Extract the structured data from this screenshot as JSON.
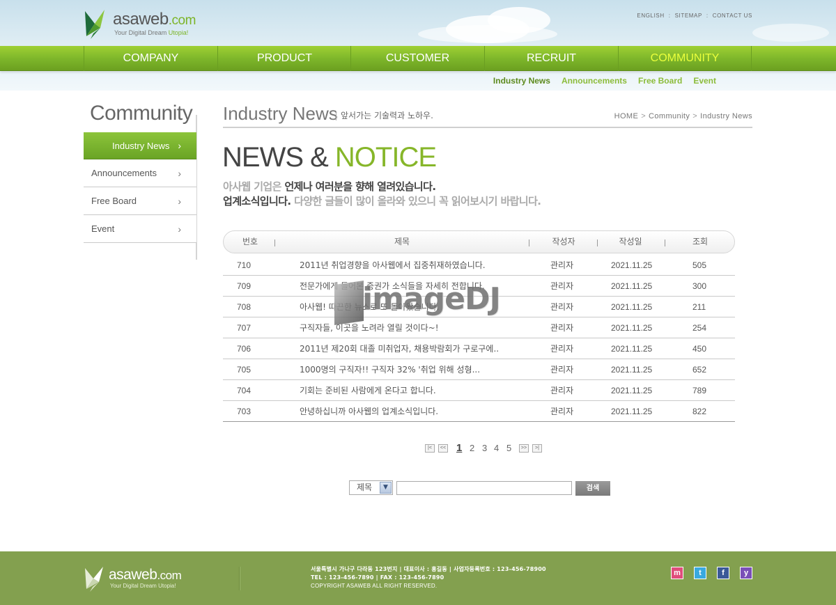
{
  "header": {
    "logo": {
      "brand": "asaweb",
      "domain": ".com",
      "tagline_prefix": "Your Digital Dream ",
      "tagline_accent": "Utopia!"
    },
    "util_nav": [
      "ENGLISH",
      "SITEMAP",
      "CONTACT US"
    ],
    "gnb": [
      "COMPANY",
      "PRODUCT",
      "CUSTOMER",
      "RECRUIT",
      "COMMUNITY"
    ],
    "gnb_active": "COMMUNITY",
    "subnav": [
      "Industry News",
      "Announcements",
      "Free Board",
      "Event"
    ],
    "subnav_active": "Industry News"
  },
  "sidebar": {
    "title": "Community",
    "items": [
      {
        "label": "Industry News",
        "active": true
      },
      {
        "label": "Announcements",
        "active": false
      },
      {
        "label": "Free Board",
        "active": false
      },
      {
        "label": "Event",
        "active": false
      }
    ],
    "arrow_glyph": "›"
  },
  "content": {
    "title": "Industry News",
    "subtitle": "앞서가는 기술력과 노하우.",
    "breadcrumb": [
      "HOME",
      "Community",
      "Industry News"
    ],
    "breadcrumb_sep": ">",
    "hero_dark": "NEWS & ",
    "hero_green": "NOTICE",
    "intro_line1_light": "아사웹 기업은 ",
    "intro_line1_dark": "언제나 여러분을 향해 열려있습니다.",
    "intro_line2_dark": "업계소식입니다. ",
    "intro_line2_light": "다양한 글들이 많이 올라와 있으니 꼭 읽어보시기 바랍니다."
  },
  "board": {
    "columns": [
      "번호",
      "제목",
      "작성자",
      "작성일",
      "조회"
    ],
    "rows": [
      {
        "no": "710",
        "title": "2011년 취업경향을 아사웹에서 집중취재하였습니다.",
        "writer": "관리자",
        "date": "2021.11.25",
        "views": "505"
      },
      {
        "no": "709",
        "title": "전문가에게 들어본 증권가 소식들을 자세히 전합니다.",
        "writer": "관리자",
        "date": "2021.11.25",
        "views": "300"
      },
      {
        "no": "708",
        "title": "아사웹! 따끈한 뉴스로 또 돌아왔습니다.",
        "writer": "관리자",
        "date": "2021.11.25",
        "views": "211"
      },
      {
        "no": "707",
        "title": "구직자들, 이곳을 노려라 열릴 것이다~!",
        "writer": "관리자",
        "date": "2021.11.25",
        "views": "254"
      },
      {
        "no": "706",
        "title": "2011년 제20회 대졸 미취업자, 채용박람회가 구로구에..",
        "writer": "관리자",
        "date": "2021.11.25",
        "views": "450"
      },
      {
        "no": "705",
        "title": "1000명의 구직자!! 구직자 32% '취업 위해 성형...",
        "writer": "관리자",
        "date": "2021.11.25",
        "views": "652"
      },
      {
        "no": "704",
        "title": "기회는 준비된 사람에게 온다고 합니다.",
        "writer": "관리자",
        "date": "2021.11.25",
        "views": "789"
      },
      {
        "no": "703",
        "title": "안녕하십니까 아사웹의 업계소식입니다.",
        "writer": "관리자",
        "date": "2021.11.25",
        "views": "822"
      }
    ]
  },
  "watermark": "imageDJ",
  "pagination": {
    "first": "|<",
    "prev": "<<",
    "next": ">>",
    "last": ">|",
    "pages": [
      "1",
      "2",
      "3",
      "4",
      "5"
    ],
    "current": "1"
  },
  "search": {
    "select_value": "제목",
    "select_arrow": "▼",
    "input_value": "",
    "button_label": "검색"
  },
  "footer": {
    "logo": {
      "brand": "asaweb",
      "domain": ".com",
      "tagline": "Your Digital Dream Utopia!"
    },
    "address_line": "서울특별시 가나구 다라동 123번지  |  대표이사 : 홍길동  |  사업자등록번호 : 123-456-78900",
    "contact_line": "TEL : 123-456-7890  |  FAX : 123-456-7890",
    "copyright": "COPYRIGHT ASAWEB ALL RIGHT RESERVED.",
    "sns": [
      {
        "name": "me2day-icon",
        "glyph": "m",
        "color": "#e04d7b"
      },
      {
        "name": "twitter-icon",
        "glyph": "t",
        "color": "#39a9e0"
      },
      {
        "name": "facebook-icon",
        "glyph": "f",
        "color": "#3b5998"
      },
      {
        "name": "yozm-icon",
        "glyph": "y",
        "color": "#7a4fb8"
      }
    ]
  },
  "colors": {
    "accent_green": "#7cb427",
    "gnb_active_text": "#eaff3c",
    "footer_bg": "#83a04f"
  }
}
